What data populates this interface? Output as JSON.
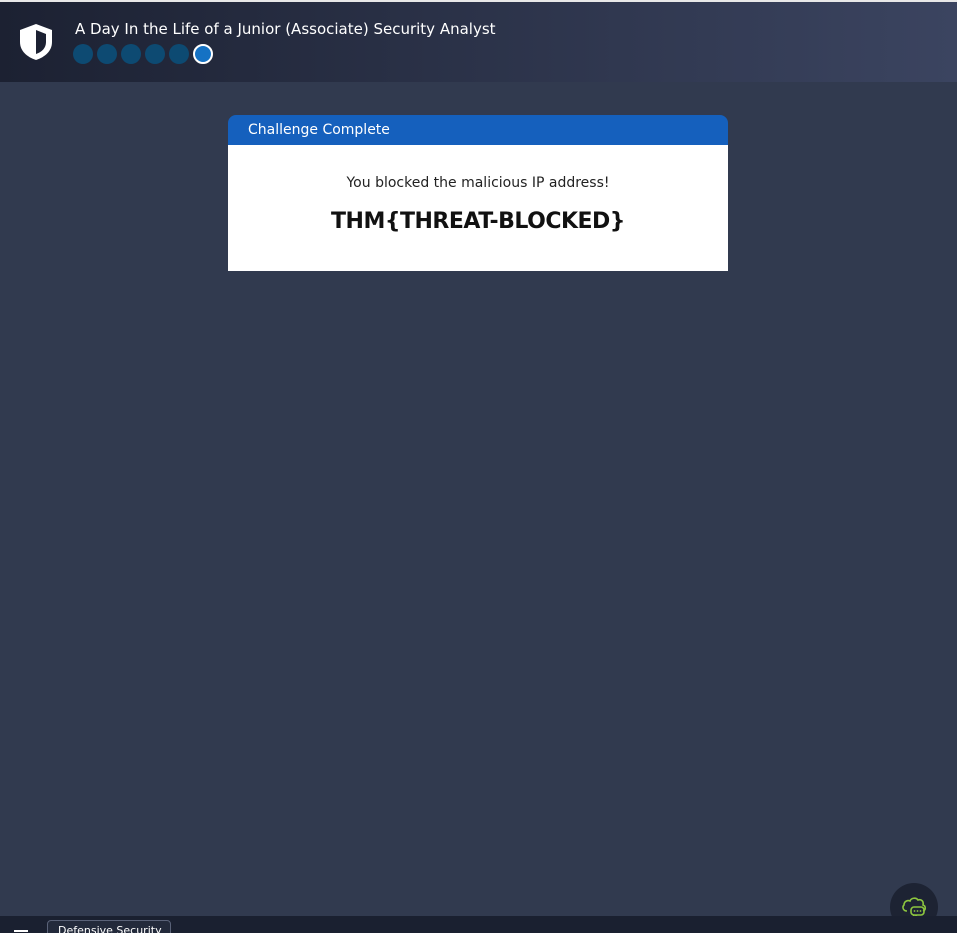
{
  "header": {
    "title": "A Day In the Life of a Junior (Associate) Security Analyst",
    "progress": {
      "total_steps": 6,
      "current_step": 6
    }
  },
  "modal": {
    "header_label": "Challenge Complete",
    "message": "You blocked the malicious IP address!",
    "flag": "THM{THREAT-BLOCKED}"
  },
  "taskbar": {
    "tab_label": "Defensive Security"
  },
  "icons": {
    "logo": "shield-icon",
    "menu": "menu-icon",
    "chat": "chat-cloud-icon"
  },
  "colors": {
    "background": "#313a4f",
    "modal_header": "#1560bd",
    "progress_dot": "#0d4a72",
    "progress_current": "#1572c4",
    "chat_icon": "#8dc63f"
  }
}
